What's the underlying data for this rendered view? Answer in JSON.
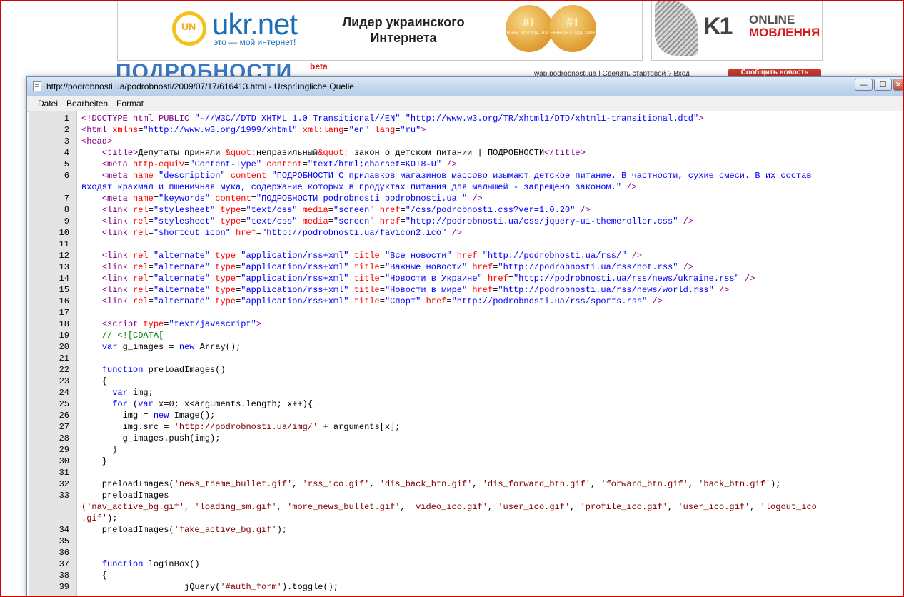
{
  "background_site": {
    "ukr_logo_mark": "UN",
    "ukr_name": "ukr.net",
    "ukr_slogan": "это — мой интернет!",
    "ukr_leader_line1": "Лидер украинского",
    "ukr_leader_line2": "Интернета",
    "medal1": {
      "top": "#1",
      "sub": "ВЫБОР ГОДА 2007"
    },
    "medal2": {
      "top": "#1",
      "sub": "ВЫБОР ГОДА 2008"
    },
    "k1_logo": "K1",
    "k1_online": "ONLINE",
    "k1_movlennya": "МОВЛЕННЯ",
    "podrobnosti_logo": "ПОДРОБНОСТИ",
    "podrobnosti_beta": "beta",
    "top_links": "wap.podrobnosti.ua  |  Сделать стартовой  ? Вход",
    "report_button": "Сообщить новость"
  },
  "window": {
    "title": "http://podrobnosti.ua/podrobnosti/2009/07/17/616413.html - Ursprüngliche Quelle",
    "controls": {
      "minimize": "—",
      "maximize": "☐",
      "close": "✕"
    },
    "menu": [
      "Datei",
      "Bearbeiten",
      "Format"
    ]
  },
  "source_lines": [
    {
      "n": "1",
      "html": "<span class=\"t\">&lt;!DOCTYPE html PUBLIC</span> <span class=\"v\">\"-//W3C//DTD XHTML 1.0 Transitional//EN\"</span> <span class=\"v\">\"http://www.w3.org/TR/xhtml1/DTD/xhtml1-transitional.dtd\"</span><span class=\"t\">&gt;</span>"
    },
    {
      "n": "2",
      "html": "<span class=\"t\">&lt;html</span> <span class=\"a\">xmlns</span>=<span class=\"v\">\"http://www.w3.org/1999/xhtml\"</span> <span class=\"a\">xml:lang</span>=<span class=\"v\">\"en\"</span> <span class=\"a\">lang</span>=<span class=\"v\">\"ru\"</span><span class=\"t\">&gt;</span>"
    },
    {
      "n": "3",
      "html": "<span class=\"t\">&lt;head&gt;</span>"
    },
    {
      "n": "4",
      "html": "    <span class=\"t\">&lt;title&gt;</span>Депутаты приняли <span class=\"a\">&amp;quot;</span>неправильный<span class=\"a\">&amp;quot;</span> закон о детском питании | ПОДРОБНОСТИ<span class=\"t\">&lt;/title&gt;</span>"
    },
    {
      "n": "5",
      "html": "    <span class=\"t\">&lt;meta</span> <span class=\"a\">http-equiv</span>=<span class=\"v\">\"Content-Type\"</span> <span class=\"a\">content</span>=<span class=\"v\">\"text/html;charset=KOI8-U\"</span> <span class=\"t\">/&gt;</span>"
    },
    {
      "n": "6",
      "html": "    <span class=\"t\">&lt;meta</span> <span class=\"a\">name</span>=<span class=\"v\">\"description\"</span> <span class=\"a\">content</span>=<span class=\"v\">\"ПОДРОБНОСТИ С прилавков магазинов массово изымают детское питание. В частности, сухие смеси. В их состав</span>"
    },
    {
      "n": "",
      "html": "<span class=\"v\">входят крахмал и пшеничная мука, содержание которых в продуктах питания для малышей - запрещено законом.\"</span> <span class=\"t\">/&gt;</span>"
    },
    {
      "n": "7",
      "html": "    <span class=\"t\">&lt;meta</span> <span class=\"a\">name</span>=<span class=\"v\">\"keywords\"</span> <span class=\"a\">content</span>=<span class=\"v\">\"ПОДРОБНОСТИ podrobnosti podrobnosti.ua \"</span> <span class=\"t\">/&gt;</span>"
    },
    {
      "n": "8",
      "html": "    <span class=\"t\">&lt;link</span> <span class=\"a\">rel</span>=<span class=\"v\">\"stylesheet\"</span> <span class=\"a\">type</span>=<span class=\"v\">\"text/css\"</span> <span class=\"a\">media</span>=<span class=\"v\">\"screen\"</span> <span class=\"a\">href</span>=<span class=\"v\">\"/css/podrobnosti.css?ver=1.0.20\"</span> <span class=\"t\">/&gt;</span>"
    },
    {
      "n": "9",
      "html": "    <span class=\"t\">&lt;link</span> <span class=\"a\">rel</span>=<span class=\"v\">\"stylesheet\"</span> <span class=\"a\">type</span>=<span class=\"v\">\"text/css\"</span> <span class=\"a\">media</span>=<span class=\"v\">\"screen\"</span> <span class=\"a\">href</span>=<span class=\"v\">\"http://podrobnosti.ua/css/jquery-ui-themeroller.css\"</span> <span class=\"t\">/&gt;</span>"
    },
    {
      "n": "10",
      "html": "    <span class=\"t\">&lt;link</span> <span class=\"a\">rel</span>=<span class=\"v\">\"shortcut icon\"</span> <span class=\"a\">href</span>=<span class=\"v\">\"http://podrobnosti.ua/favicon2.ico\"</span> <span class=\"t\">/&gt;</span>"
    },
    {
      "n": "11",
      "html": ""
    },
    {
      "n": "12",
      "html": "    <span class=\"t\">&lt;link</span> <span class=\"a\">rel</span>=<span class=\"v\">\"alternate\"</span> <span class=\"a\">type</span>=<span class=\"v\">\"application/rss+xml\"</span> <span class=\"a\">title</span>=<span class=\"v\">\"Все новости\"</span> <span class=\"a\">href</span>=<span class=\"v\">\"http://podrobnosti.ua/rss/\"</span> <span class=\"t\">/&gt;</span>"
    },
    {
      "n": "13",
      "html": "    <span class=\"t\">&lt;link</span> <span class=\"a\">rel</span>=<span class=\"v\">\"alternate\"</span> <span class=\"a\">type</span>=<span class=\"v\">\"application/rss+xml\"</span> <span class=\"a\">title</span>=<span class=\"v\">\"Важные новости\"</span> <span class=\"a\">href</span>=<span class=\"v\">\"http://podrobnosti.ua/rss/hot.rss\"</span> <span class=\"t\">/&gt;</span>"
    },
    {
      "n": "14",
      "html": "    <span class=\"t\">&lt;link</span> <span class=\"a\">rel</span>=<span class=\"v\">\"alternate\"</span> <span class=\"a\">type</span>=<span class=\"v\">\"application/rss+xml\"</span> <span class=\"a\">title</span>=<span class=\"v\">\"Новости в Украине\"</span> <span class=\"a\">href</span>=<span class=\"v\">\"http://podrobnosti.ua/rss/news/ukraine.rss\"</span> <span class=\"t\">/&gt;</span>"
    },
    {
      "n": "15",
      "html": "    <span class=\"t\">&lt;link</span> <span class=\"a\">rel</span>=<span class=\"v\">\"alternate\"</span> <span class=\"a\">type</span>=<span class=\"v\">\"application/rss+xml\"</span> <span class=\"a\">title</span>=<span class=\"v\">\"Новости в мире\"</span> <span class=\"a\">href</span>=<span class=\"v\">\"http://podrobnosti.ua/rss/news/world.rss\"</span> <span class=\"t\">/&gt;</span>"
    },
    {
      "n": "16",
      "html": "    <span class=\"t\">&lt;link</span> <span class=\"a\">rel</span>=<span class=\"v\">\"alternate\"</span> <span class=\"a\">type</span>=<span class=\"v\">\"application/rss+xml\"</span> <span class=\"a\">title</span>=<span class=\"v\">\"Спорт\"</span> <span class=\"a\">href</span>=<span class=\"v\">\"http://podrobnosti.ua/rss/sports.rss\"</span> <span class=\"t\">/&gt;</span>"
    },
    {
      "n": "17",
      "html": ""
    },
    {
      "n": "18",
      "html": "    <span class=\"t\">&lt;script</span> <span class=\"a\">type</span>=<span class=\"v\">\"text/javascript\"</span><span class=\"t\">&gt;</span>"
    },
    {
      "n": "19",
      "html": "    <span class=\"c\">// &lt;![CDATA[</span>"
    },
    {
      "n": "20",
      "html": "    <span class=\"k\">var</span> g_images = <span class=\"k\">new</span> Array();"
    },
    {
      "n": "21",
      "html": ""
    },
    {
      "n": "22",
      "html": "    <span class=\"k\">function</span> preloadImages()"
    },
    {
      "n": "23",
      "html": "    {"
    },
    {
      "n": "24",
      "html": "      <span class=\"k\">var</span> img;"
    },
    {
      "n": "25",
      "html": "      <span class=\"k\">for</span> (<span class=\"k\">var</span> x=0; x&lt;arguments.length; x++){"
    },
    {
      "n": "26",
      "html": "        img = <span class=\"k\">new</span> Image();"
    },
    {
      "n": "27",
      "html": "        img.src = <span class=\"s\">'http://podrobnosti.ua/img/'</span> + arguments[x];"
    },
    {
      "n": "28",
      "html": "        g_images.push(img);"
    },
    {
      "n": "29",
      "html": "      }"
    },
    {
      "n": "30",
      "html": "    }"
    },
    {
      "n": "31",
      "html": ""
    },
    {
      "n": "32",
      "html": "    preloadImages(<span class=\"s\">'news_theme_bullet.gif'</span>, <span class=\"s\">'rss_ico.gif'</span>, <span class=\"s\">'dis_back_btn.gif'</span>, <span class=\"s\">'dis_forward_btn.gif'</span>, <span class=\"s\">'forward_btn.gif'</span>, <span class=\"s\">'back_btn.gif'</span>);"
    },
    {
      "n": "33",
      "html": "    preloadImages"
    },
    {
      "n": "",
      "html": "<span class=\"s\">('nav_active_bg.gif'</span>, <span class=\"s\">'loading_sm.gif'</span>, <span class=\"s\">'more_news_bullet.gif'</span>, <span class=\"s\">'video_ico.gif'</span>, <span class=\"s\">'user_ico.gif'</span>, <span class=\"s\">'profile_ico.gif'</span>, <span class=\"s\">'user_ico.gif'</span>, <span class=\"s\">'logout_ico</span>"
    },
    {
      "n": "",
      "html": "<span class=\"s\">.gif'</span>);"
    },
    {
      "n": "34",
      "html": "    preloadImages(<span class=\"s\">'fake_active_bg.gif'</span>);"
    },
    {
      "n": "35",
      "html": ""
    },
    {
      "n": "36",
      "html": ""
    },
    {
      "n": "37",
      "html": "    <span class=\"k\">function</span> loginBox()"
    },
    {
      "n": "38",
      "html": "    {"
    },
    {
      "n": "39",
      "html": "                    jQuery(<span class=\"s\">'#auth_form'</span>).toggle();"
    }
  ]
}
